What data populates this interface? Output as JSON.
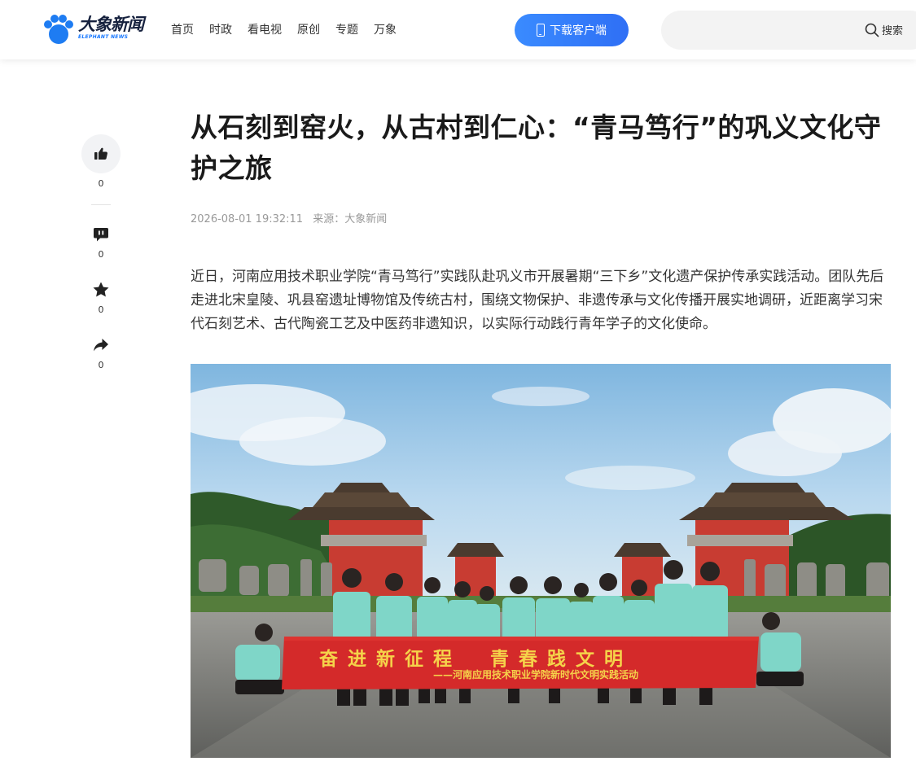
{
  "header": {
    "logo_cn": "大象新闻",
    "logo_en": "ELEPHANT NEWS",
    "nav": [
      "首页",
      "时政",
      "看电视",
      "原创",
      "专题",
      "万象"
    ],
    "download_label": "下载客户端",
    "search_placeholder": "",
    "search_label": "搜索"
  },
  "side": {
    "like_count": "0",
    "comment_count": "0",
    "favorite_count": "0",
    "share_count": "0"
  },
  "article": {
    "title": "从石刻到窑火，从古村到仁心：“青马笃行”的巩义文化守护之旅",
    "datetime": "2026-08-01 19:32:11",
    "source": "来源：大象新闻",
    "paragraph": "近日，河南应用技术职业学院“青马笃行”实践队赴巩义市开展暑期“三下乡”文化遗产保护传承实践活动。团队先后走进北宋皇陵、巩县窑遗址博物馆及传统古村，围绕文物保护、非遗传承与文化传播开展实地调研，近距离学习宋代石刻艺术、古代陶瓷工艺及中医药非遗知识，以实际行动践行青年学子的文化使命。"
  },
  "photo": {
    "banner_main": "奋进新征程　青春践文明",
    "banner_sub": "——河南应用技术职业学院新时代文明实践活动"
  },
  "colors": {
    "accent_blue": "#2f6ff5",
    "banner_red": "#d42a2a",
    "banner_text": "#f5d34a",
    "wall_red": "#c83c32",
    "shirt_teal": "#7fd6c8"
  }
}
